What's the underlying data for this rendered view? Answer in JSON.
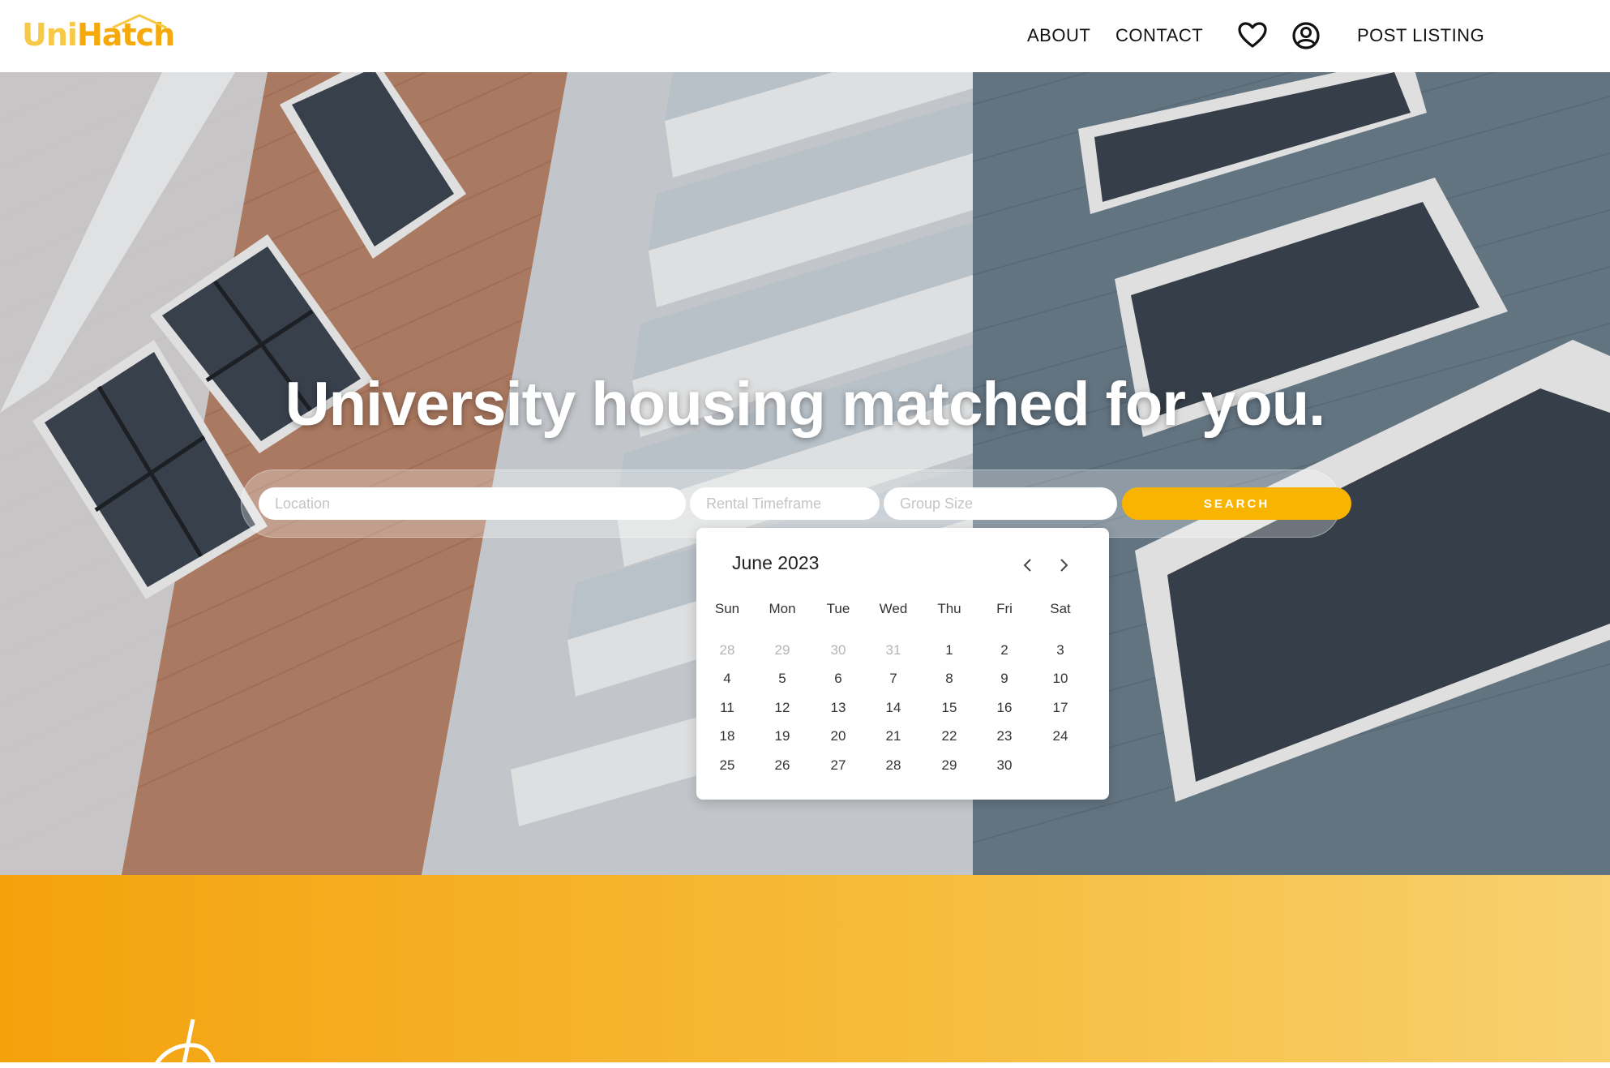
{
  "brand": {
    "part1": "Uni",
    "part2": "Hatch"
  },
  "nav": {
    "about": "ABOUT",
    "contact": "CONTACT",
    "favorites_icon": "heart-icon",
    "account_icon": "user-circle-icon",
    "post_listing": "POST LISTING"
  },
  "hero": {
    "title": "University housing matched for you."
  },
  "search": {
    "location_placeholder": "Location",
    "timeframe_placeholder": "Rental Timeframe",
    "group_placeholder": "Group Size",
    "button_label": "SEARCH"
  },
  "calendar": {
    "month_label": "June 2023",
    "prev_icon": "chevron-left-icon",
    "next_icon": "chevron-right-icon",
    "weekdays": [
      "Sun",
      "Mon",
      "Tue",
      "Wed",
      "Thu",
      "Fri",
      "Sat"
    ],
    "weeks": [
      [
        {
          "d": "28",
          "m": true
        },
        {
          "d": "29",
          "m": true
        },
        {
          "d": "30",
          "m": true
        },
        {
          "d": "31",
          "m": true
        },
        {
          "d": "1"
        },
        {
          "d": "2"
        },
        {
          "d": "3"
        }
      ],
      [
        {
          "d": "4"
        },
        {
          "d": "5"
        },
        {
          "d": "6"
        },
        {
          "d": "7"
        },
        {
          "d": "8"
        },
        {
          "d": "9"
        },
        {
          "d": "10"
        }
      ],
      [
        {
          "d": "11"
        },
        {
          "d": "12"
        },
        {
          "d": "13"
        },
        {
          "d": "14"
        },
        {
          "d": "15"
        },
        {
          "d": "16"
        },
        {
          "d": "17"
        }
      ],
      [
        {
          "d": "18"
        },
        {
          "d": "19"
        },
        {
          "d": "20"
        },
        {
          "d": "21"
        },
        {
          "d": "22"
        },
        {
          "d": "23"
        },
        {
          "d": "24"
        }
      ],
      [
        {
          "d": "25"
        },
        {
          "d": "26"
        },
        {
          "d": "27"
        },
        {
          "d": "28"
        },
        {
          "d": "29"
        },
        {
          "d": "30"
        }
      ]
    ]
  },
  "colors": {
    "brand_light": "#f7c948",
    "brand_dark": "#f5a90a",
    "search_button": "#f8b400",
    "promo_start": "#f4a20c",
    "promo_end": "#f8d170"
  }
}
